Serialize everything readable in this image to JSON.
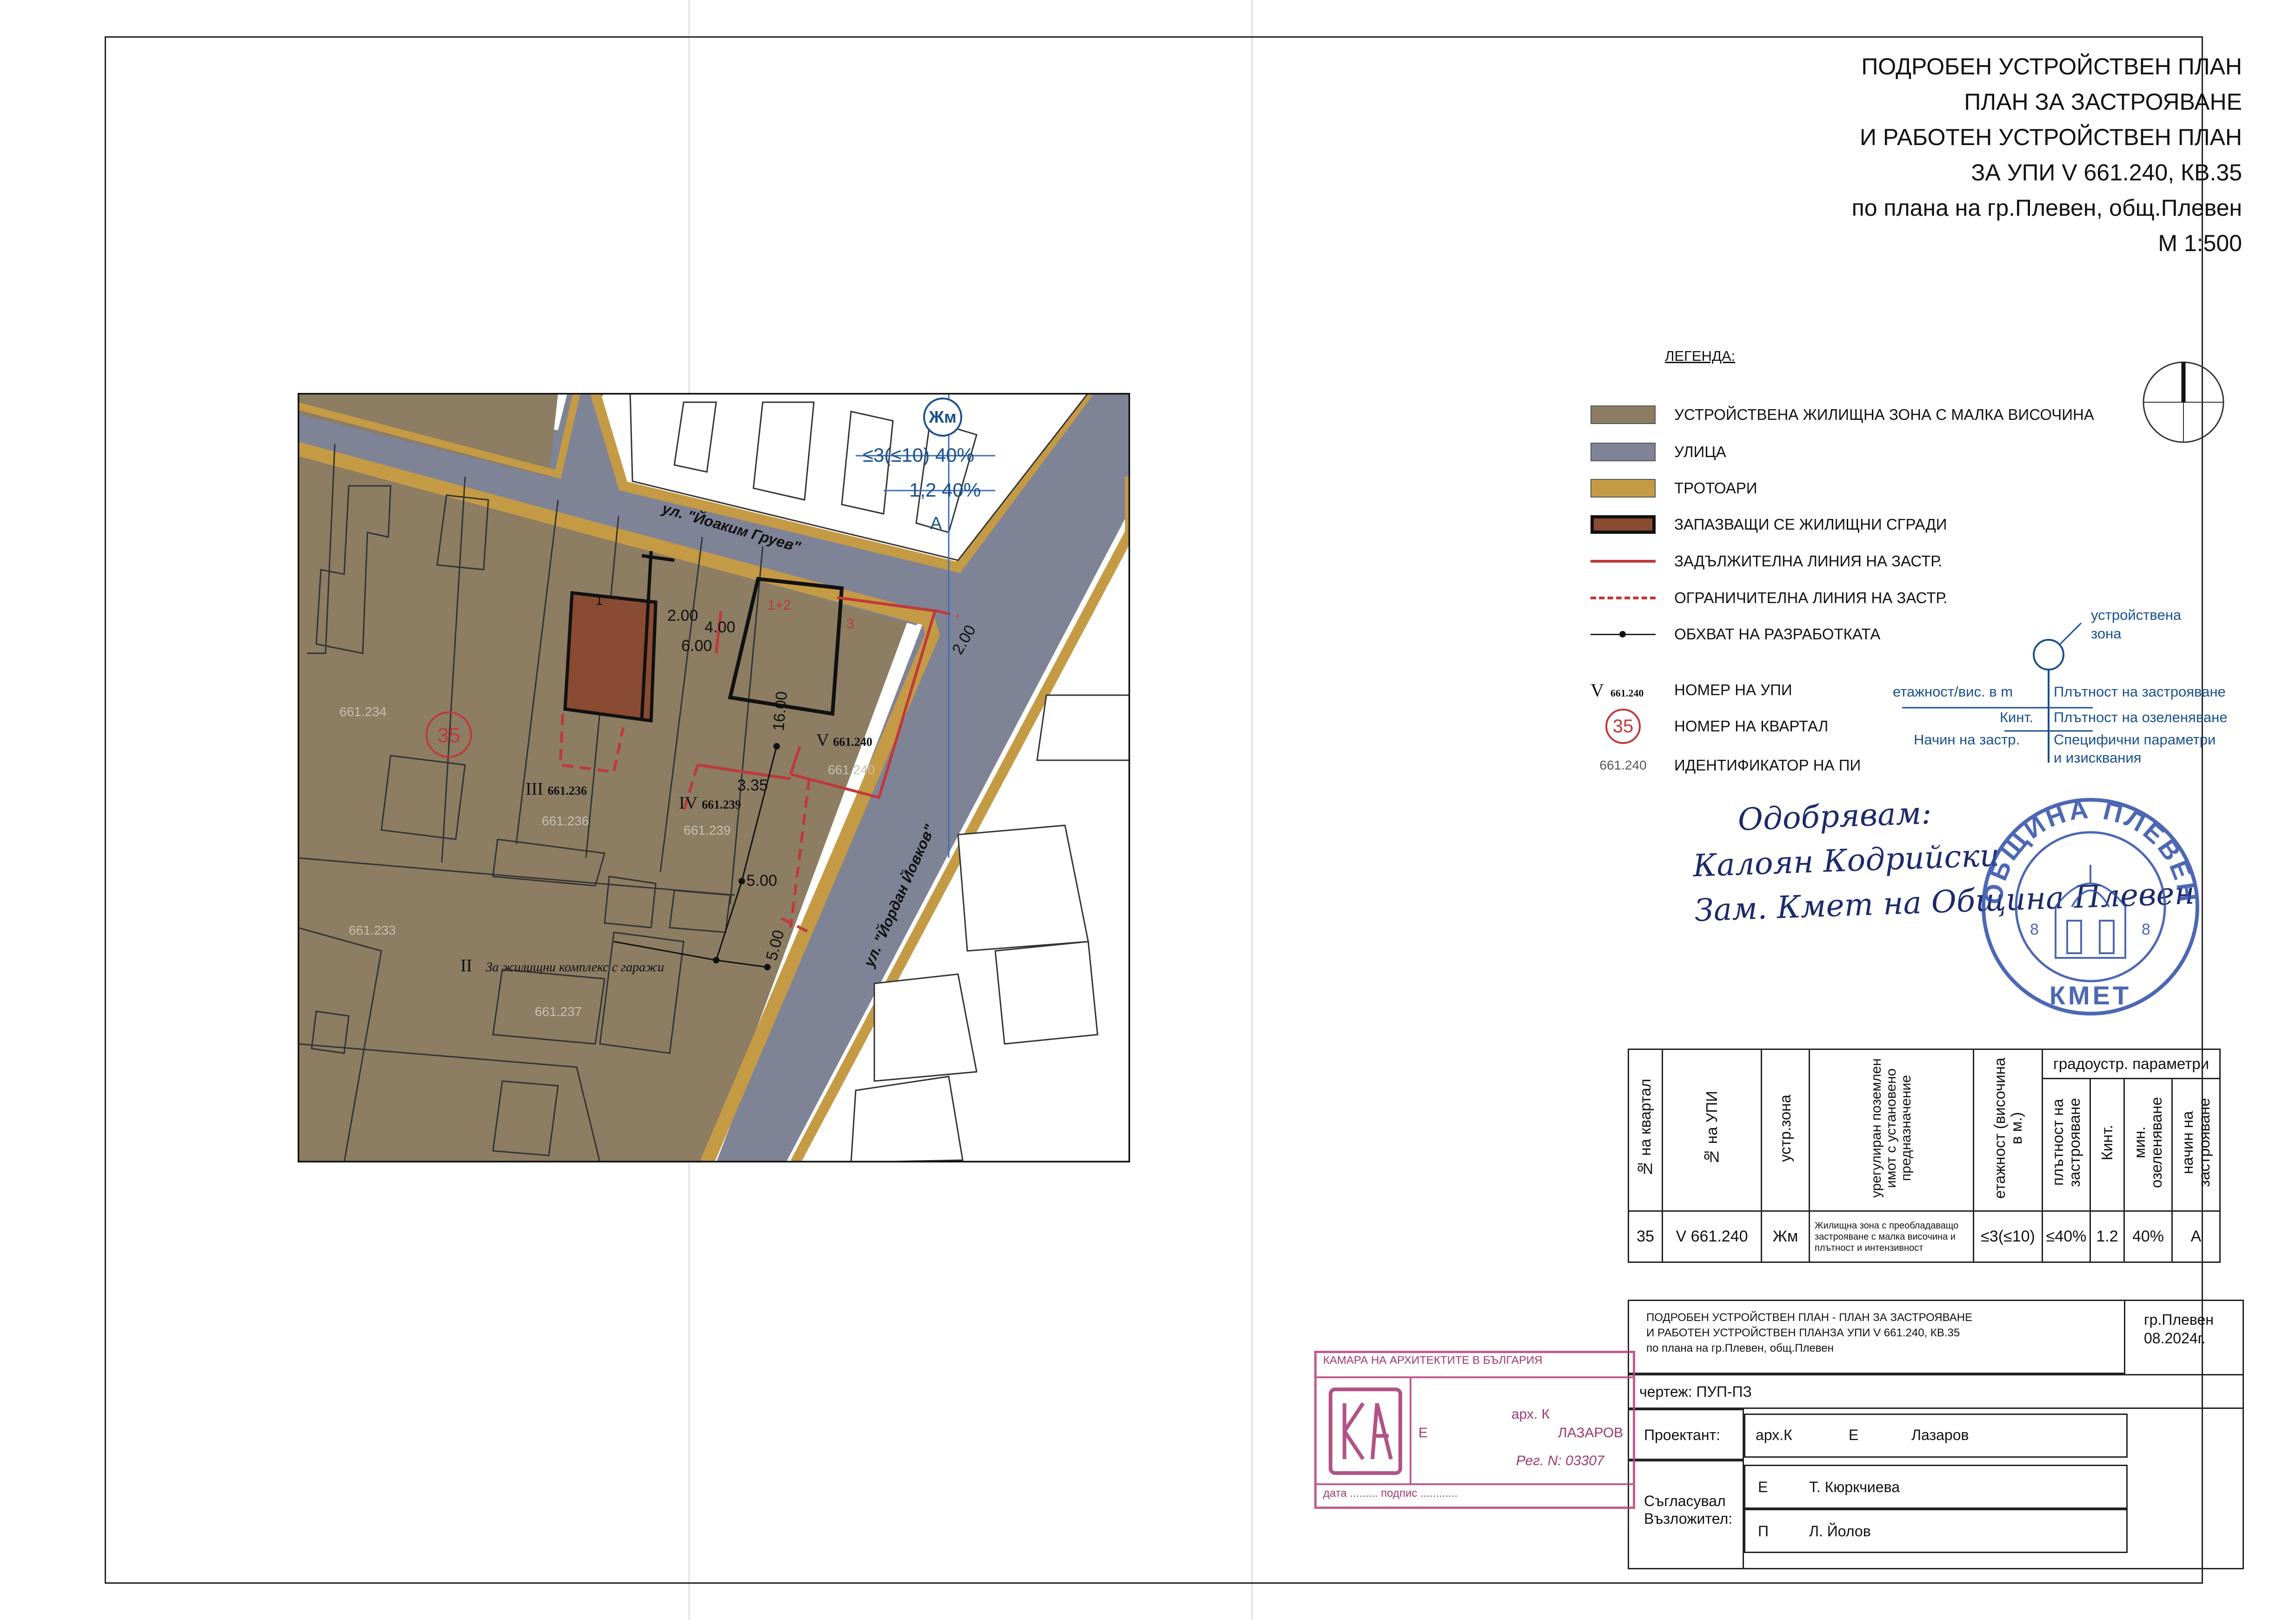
{
  "title": {
    "line1": "ПОДРОБЕН УСТРОЙСТВЕН ПЛАН",
    "line2": "ПЛАН ЗА ЗАСТРОЯВАНЕ",
    "line3": "И РАБОТЕН УСТРОЙСТВЕН ПЛАН",
    "line4": "ЗА УПИ V 661.240, КВ.35",
    "line5": "по плана на гр.Плевен, общ.Плевен",
    "scale": "М 1:500"
  },
  "legend": {
    "heading": "ЛЕГЕНДА:",
    "items": [
      {
        "label": "УСТРОЙСТВЕНА ЖИЛИЩНА ЗОНА С МАЛКА ВИСОЧИНА",
        "color": "#8c7d63"
      },
      {
        "label": "УЛИЦА",
        "color": "#7f8396"
      },
      {
        "label": "ТРОТОАРИ",
        "color": "#c49a44"
      },
      {
        "label": "ЗАПАЗВАЩИ СЕ ЖИЛИЩНИ СГРАДИ",
        "color": "#8a4b33"
      },
      {
        "label": "ЗАДЪЛЖИТЕЛНА ЛИНИЯ НА ЗАСТР.",
        "color": "#c0393b"
      },
      {
        "label": "ОГРАНИЧИТЕЛНА ЛИНИЯ НА ЗАСТР.",
        "color": "#c0393b"
      },
      {
        "label": "ОБХВАТ НА РАЗРАБОТКАТА",
        "color": "#222222"
      },
      {
        "label": "НОМЕР НА УПИ",
        "symbol": "V",
        "symbol_sub": "661.240"
      },
      {
        "label": "НОМЕР НА КВАРТАЛ",
        "symbol": "35"
      },
      {
        "label": "ИДЕНТИФИКАТОР НА ПИ",
        "symbol": "661.240"
      }
    ],
    "zone_key": {
      "zone_label_1": "устройствена",
      "zone_label_2": "зона",
      "left_1": "етажност/вис. в m",
      "left_2": "Кинт.",
      "left_3": "Начин на застр.",
      "right_1": "Плътност на застрояване",
      "right_2": "Плътност на озеленяване",
      "right_3": "Специфични параметри",
      "right_4": "и изисквания"
    }
  },
  "map": {
    "zone_circle": "Жм",
    "params_top": "≤3(≤10) 40%",
    "params_mid": "1,2 40%",
    "params_bot": "А",
    "street_north": "ул. \"Йоаким Груев\"",
    "street_east": "ул. \"Йордан Йовков\"",
    "quarter": "35",
    "upi_labels": [
      {
        "roman": "III",
        "id": "661.236"
      },
      {
        "roman": "IV",
        "id": "661.239"
      },
      {
        "roman": "V",
        "id": "661.240"
      },
      {
        "roman": "II",
        "text": "За жилищни комплекс с гаражи"
      }
    ],
    "parcel_ids": [
      "661.234",
      "661.236",
      "661.239",
      "661.240",
      "661.233",
      "661.237"
    ],
    "dims": [
      "2.00",
      "4.00",
      "6.00",
      "16.00",
      "3.35",
      "5.00",
      "5.00",
      "2.00"
    ],
    "building_labels": [
      "1",
      "1+2",
      "3"
    ]
  },
  "approval": {
    "line1": "Одобрявам:",
    "line2": "Калоян Кодрийски",
    "line3": "Зам. Кмет на Община Плевен"
  },
  "blue_stamp": {
    "top": "ОБЩИНА ПЛЕВЕН",
    "bottom": "КМЕТ",
    "num_left": "8",
    "num_right": "8"
  },
  "params_table": {
    "headers": [
      "№ на квартал",
      "№ на УПИ",
      "устр.зона",
      "урегулиран поземлен имот с установено предназначение",
      "етажност (височина в м.)",
      "плътност на застрояване",
      "Кинт.",
      "мин. озеленяване",
      "начин на застрояване"
    ],
    "group_header": "градоустр. параметри",
    "row": [
      "35",
      "V 661.240",
      "Жм",
      "Жилищна зона с преобладаващо застрояване с малка височина и плътност и интензивност",
      "≤3(≤10)",
      "≤40%",
      "1.2",
      "40%",
      "А"
    ]
  },
  "title_block": {
    "desc_1": "ПОДРОБЕН УСТРОЙСТВЕН ПЛАН - ПЛАН ЗА ЗАСТРОЯВАНЕ",
    "desc_2": "И РАБОТЕН УСТРОЙСТВЕН ПЛАНЗА УПИ V 661.240, КВ.35",
    "desc_3": "по плана на гр.Плевен, общ.Плевен",
    "place": "гр.Плевен",
    "date": "08.2024г.",
    "drawing": "чертеж: ПУП-ПЗ",
    "designer_label": "Проектант:",
    "designer_value_1": "арх.К",
    "designer_value_2": "Е",
    "designer_value_3": "Лазаров",
    "agreed_label_1": "Съгласувал",
    "agreed_label_2": "Възложител:",
    "agreed_1_init": "Е",
    "agreed_1_name": "Т. Кюркчиева",
    "agreed_2_init": "П",
    "agreed_2_name": "Л. Йолов"
  },
  "pink_stamp": {
    "header": "КАМАРА НА АРХИТЕКТИТЕ В БЪЛГАРИЯ",
    "name_1": "арх. К",
    "name_2": "Е",
    "name_3": "ЛАЗАРОВ",
    "reg": "Рег. N: 03307",
    "footer": "дата ......... подпис ............"
  }
}
